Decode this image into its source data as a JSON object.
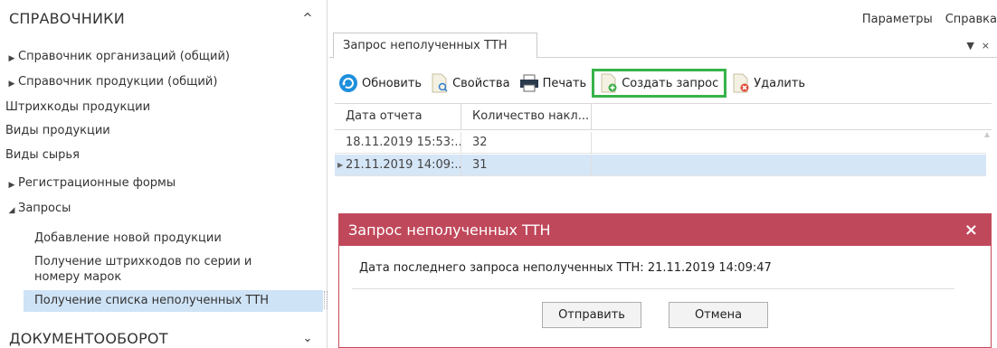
{
  "sidebar": {
    "section1_title": "СПРАВОЧНИКИ",
    "section1_arrow": "^",
    "items": [
      {
        "label": "Справочник организаций (общий)",
        "expander": "▶"
      },
      {
        "label": "Справочник продукции (общий)",
        "expander": "▶"
      },
      {
        "label": "Штрихкоды продукции",
        "expander": ""
      },
      {
        "label": "Виды продукции",
        "expander": ""
      },
      {
        "label": "Виды сырья",
        "expander": ""
      },
      {
        "label": "Регистрационные формы",
        "expander": "▶"
      },
      {
        "label": "Запросы",
        "expander": "◢"
      },
      {
        "label": "Добавление новой продукции",
        "expander": ""
      },
      {
        "label": "Получение штрихкодов по серии и номеру марок",
        "expander": ""
      },
      {
        "label": "Получение списка неполученных ТТН",
        "expander": ""
      }
    ],
    "section2_title": "ДОКУМЕНТООБОРОТ",
    "section2_arrow": "⌄"
  },
  "menu": {
    "params": "Параметры",
    "help": "Справка"
  },
  "tab": {
    "label": "Запрос неполученных ТТН",
    "dropdown": "▼",
    "close": "×"
  },
  "toolbar": {
    "refresh": "Обновить",
    "properties": "Свойства",
    "print": "Печать",
    "create_request": "Создать запрос",
    "delete": "Удалить"
  },
  "grid": {
    "columns": [
      "Дата отчета",
      "Количество накл..."
    ],
    "rows": [
      {
        "date": "18.11.2019 15:53:...",
        "count": "32"
      },
      {
        "date": "21.11.2019 14:09:...",
        "count": "31"
      }
    ],
    "row_indicator": "▶"
  },
  "dialog": {
    "title": "Запрос неполученных ТТН",
    "close": "×",
    "message": "Дата последнего запроса неполученных ТТН: 21.11.2019 14:09:47",
    "send": "Отправить",
    "cancel": "Отмена"
  },
  "colors": {
    "dialog_header": "#c0485b",
    "selection": "#cfe3f6",
    "highlight_border": "#36b34a"
  }
}
